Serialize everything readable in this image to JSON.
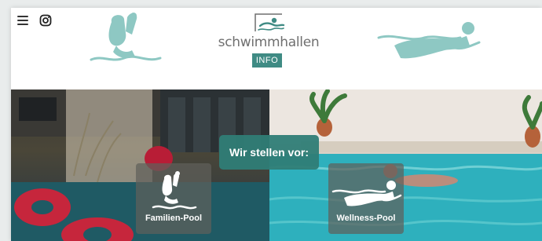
{
  "header": {
    "menu_icon": "hamburger-menu-icon",
    "social_icon": "instagram-icon",
    "logo": {
      "text": "schwimmhallen",
      "badge": "INFO"
    },
    "decorations": [
      "family-swimmer-icon",
      "floating-swimmer-icon"
    ]
  },
  "hero": {
    "intro_label": "Wir stellen vor:",
    "tiles": [
      {
        "label": "Familien-Pool",
        "icon": "family-swimmer-icon"
      },
      {
        "label": "Wellness-Pool",
        "icon": "floating-swimmer-icon"
      }
    ]
  },
  "colors": {
    "brand_teal": "#3f8b84",
    "icon_teal": "#8ec8c3",
    "label_bg": "#2f7d76"
  }
}
